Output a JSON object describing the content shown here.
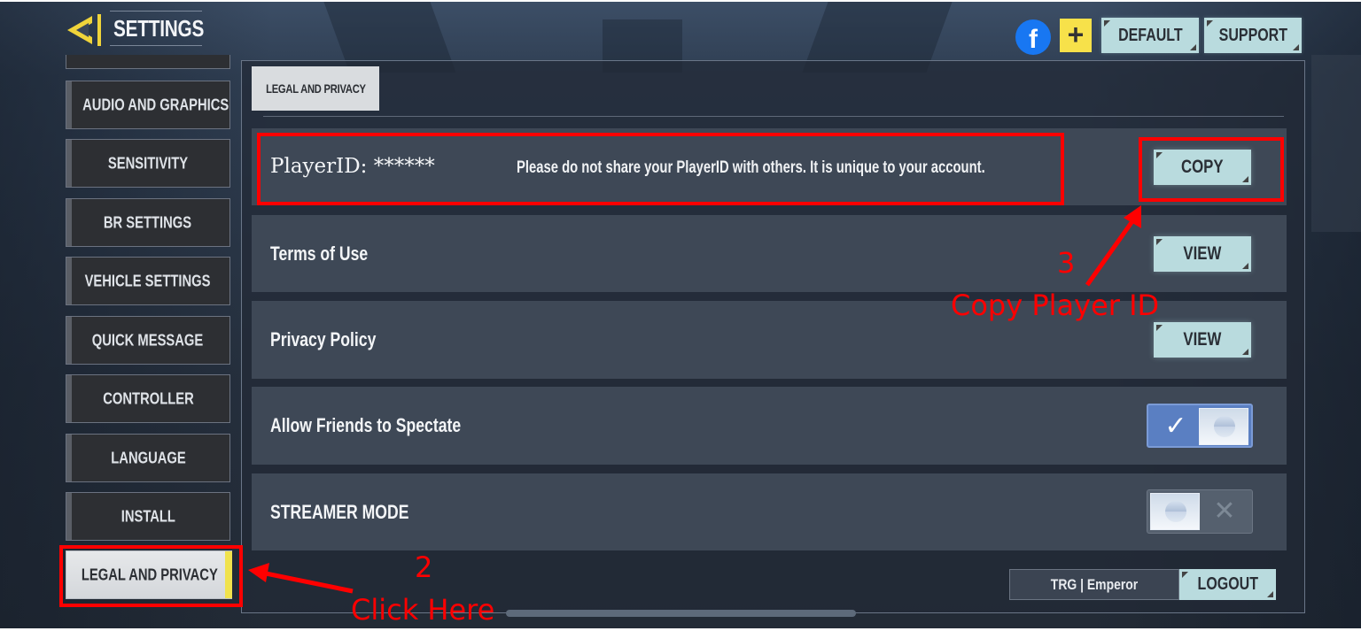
{
  "header": {
    "title": "SETTINGS",
    "back_icon": "back-arrow-icon",
    "facebook_icon": "facebook-icon",
    "facebook_glyph": "f",
    "plus_icon": "plus-icon",
    "plus_glyph": "+",
    "default_label": "DEFAULT",
    "support_label": "SUPPORT"
  },
  "sidebar": {
    "items": [
      {
        "label": "AUDIO AND GRAPHICS",
        "active": false
      },
      {
        "label": "SENSITIVITY",
        "active": false
      },
      {
        "label": "BR SETTINGS",
        "active": false
      },
      {
        "label": "VEHICLE SETTINGS",
        "active": false
      },
      {
        "label": "QUICK MESSAGE",
        "active": false
      },
      {
        "label": "CONTROLLER",
        "active": false
      },
      {
        "label": "LANGUAGE",
        "active": false
      },
      {
        "label": "INSTALL",
        "active": false
      },
      {
        "label": "LEGAL AND PRIVACY",
        "active": true
      }
    ]
  },
  "main": {
    "tab_label": "LEGAL AND PRIVACY",
    "player_id": {
      "label": "PlayerID: ******",
      "note": "Please do not share your PlayerID with others. It is unique to your account.",
      "button": "COPY"
    },
    "rows": [
      {
        "label": "Terms of Use",
        "button": "VIEW"
      },
      {
        "label": "Privacy Policy",
        "button": "VIEW"
      },
      {
        "label": "Allow Friends to Spectate",
        "toggle": true,
        "on_glyph": "✓"
      },
      {
        "label": "STREAMER MODE",
        "toggle": false,
        "off_glyph": "✕"
      }
    ],
    "account": "TRG | Emperor",
    "logout_label": "LOGOUT"
  },
  "annotations": {
    "step2_number": "2",
    "step2_text": "Click Here",
    "step3_number": "3",
    "step3_text": "Copy Player ID",
    "color": "#ff0000"
  },
  "colors": {
    "button_bg": "#b9dbde",
    "active_accent": "#f0e24d",
    "toggle_on": "#5a7fc2",
    "facebook": "#1877f2"
  }
}
